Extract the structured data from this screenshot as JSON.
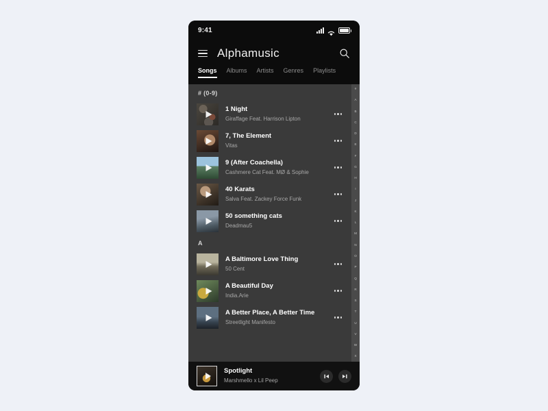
{
  "status_bar": {
    "time": "9:41",
    "signal_icon": "cellular-signal-icon",
    "wifi_icon": "wifi-icon",
    "battery_icon": "battery-icon"
  },
  "app_bar": {
    "menu_icon": "hamburger-menu-icon",
    "title": "Alphamusic",
    "search_icon": "search-icon"
  },
  "tabs": [
    {
      "label": "Songs",
      "active": true
    },
    {
      "label": "Albums",
      "active": false
    },
    {
      "label": "Artists",
      "active": false
    },
    {
      "label": "Genres",
      "active": false
    },
    {
      "label": "Playlists",
      "active": false
    }
  ],
  "sections": [
    {
      "header": "# (0-9)",
      "songs": [
        {
          "title": "1 Night",
          "artist": "Giraffage Feat. Harrison Lipton"
        },
        {
          "title": "7, The Element",
          "artist": "Vitas"
        },
        {
          "title": "9 (After Coachella)",
          "artist": "Cashmere Cat Feat. MØ & Sophie"
        },
        {
          "title": "40 Karats",
          "artist": "Salva Feat. Zackey Force Funk"
        },
        {
          "title": "50 something cats",
          "artist": "Deadmau5"
        }
      ]
    },
    {
      "header": "A",
      "songs": [
        {
          "title": "A Baltimore Love Thing",
          "artist": "50 Cent"
        },
        {
          "title": "A Beautiful Day",
          "artist": "India.Arie"
        },
        {
          "title": "A Better Place, A Better Time",
          "artist": "Streetlight Manifesto"
        }
      ]
    }
  ],
  "alphabet_index": [
    "#",
    "A",
    "B",
    "C",
    "D",
    "E",
    "F",
    "G",
    "H",
    "I",
    "J",
    "K",
    "L",
    "M",
    "N",
    "O",
    "P",
    "Q",
    "R",
    "S",
    "T",
    "U",
    "V",
    "W",
    "X"
  ],
  "now_playing": {
    "title": "Spotlight",
    "artist": "Marshmello x Lil Peep",
    "play_overlay_icon": "play-icon",
    "previous_icon": "skip-previous-icon",
    "next_icon": "skip-next-icon"
  },
  "row_menu_icon": "more-options-icon",
  "colors": {
    "page_background": "#eef1f7",
    "chrome_background": "#0c0c0c",
    "list_background": "#3a3a3a",
    "index_background": "#4a4a4a",
    "player_background": "#111111",
    "accent": "#ffffff",
    "secondary_text": "#a9a9a9"
  }
}
